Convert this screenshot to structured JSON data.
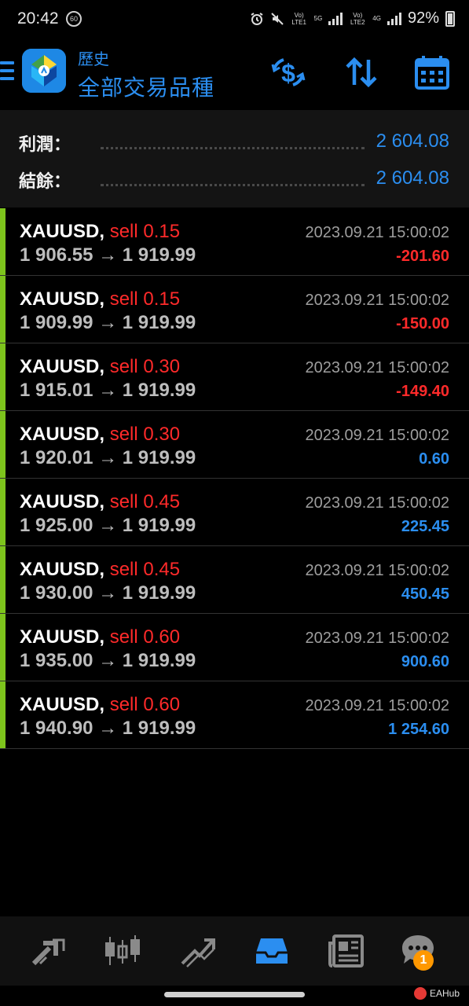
{
  "status_bar": {
    "time": "20:42",
    "sixty_badge": "60",
    "lte1": "Vo) LTE1",
    "net1": "5G",
    "lte2": "Vo) LTE2",
    "net2": "4G",
    "battery": "92%"
  },
  "header": {
    "subtitle": "歷史",
    "title": "全部交易品種"
  },
  "summary": {
    "profit_label": "利潤：",
    "profit_value": "2 604.08",
    "balance_label": "結餘：",
    "balance_value": "2 604.08"
  },
  "deals": [
    {
      "symbol": "XAUUSD,",
      "side": "sell 0.15",
      "open": "1 906.55",
      "close": "1 919.99",
      "arrow": "→",
      "time": "2023.09.21 15:00:02",
      "profit": "-201.60",
      "positive": false
    },
    {
      "symbol": "XAUUSD,",
      "side": "sell 0.15",
      "open": "1 909.99",
      "close": "1 919.99",
      "arrow": "→",
      "time": "2023.09.21 15:00:02",
      "profit": "-150.00",
      "positive": false
    },
    {
      "symbol": "XAUUSD,",
      "side": "sell 0.30",
      "open": "1 915.01",
      "close": "1 919.99",
      "arrow": "→",
      "time": "2023.09.21 15:00:02",
      "profit": "-149.40",
      "positive": false
    },
    {
      "symbol": "XAUUSD,",
      "side": "sell 0.30",
      "open": "1 920.01",
      "close": "1 919.99",
      "arrow": "→",
      "time": "2023.09.21 15:00:02",
      "profit": "0.60",
      "positive": true
    },
    {
      "symbol": "XAUUSD,",
      "side": "sell 0.45",
      "open": "1 925.00",
      "close": "1 919.99",
      "arrow": "→",
      "time": "2023.09.21 15:00:02",
      "profit": "225.45",
      "positive": true
    },
    {
      "symbol": "XAUUSD,",
      "side": "sell 0.45",
      "open": "1 930.00",
      "close": "1 919.99",
      "arrow": "→",
      "time": "2023.09.21 15:00:02",
      "profit": "450.45",
      "positive": true
    },
    {
      "symbol": "XAUUSD,",
      "side": "sell 0.60",
      "open": "1 935.00",
      "close": "1 919.99",
      "arrow": "→",
      "time": "2023.09.21 15:00:02",
      "profit": "900.60",
      "positive": true
    },
    {
      "symbol": "XAUUSD,",
      "side": "sell 0.60",
      "open": "1 940.90",
      "close": "1 919.99",
      "arrow": "→",
      "time": "2023.09.21 15:00:02",
      "profit": "1 254.60",
      "positive": true
    }
  ],
  "bottom_nav": {
    "chat_badge": "1",
    "watermark": "EAHub"
  },
  "colors": {
    "accent": "#2b8ef0",
    "negative": "#ff2a2a",
    "indicator": "#7dc41c"
  },
  "icons": [
    "menu-icon",
    "app-logo-icon",
    "currency-exchange-icon",
    "sort-icon",
    "calendar-icon",
    "quotes-icon",
    "chart-icon",
    "trade-icon",
    "history-icon",
    "news-icon",
    "chat-icon"
  ]
}
